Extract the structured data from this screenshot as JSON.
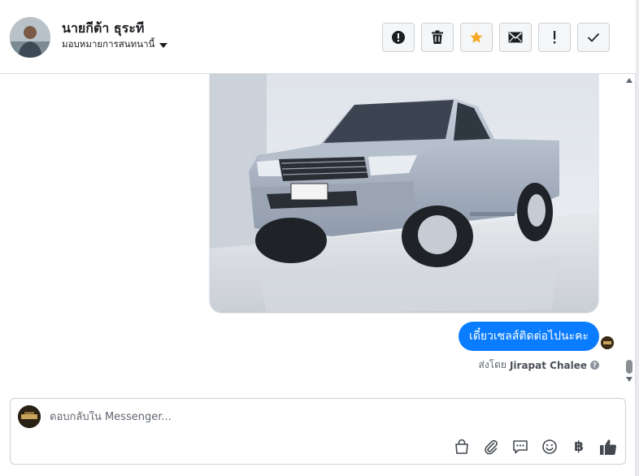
{
  "header": {
    "contact_name": "นายกีต้า ธุระที",
    "assign_label": "มอบหมายการสนทนานี้"
  },
  "actions": [
    {
      "name": "spam-button",
      "icon": "alert-circle-icon"
    },
    {
      "name": "delete-button",
      "icon": "trash-icon"
    },
    {
      "name": "star-button",
      "icon": "star-icon",
      "color": "#f5a623"
    },
    {
      "name": "mark-unread-button",
      "icon": "envelope-icon"
    },
    {
      "name": "follow-up-button",
      "icon": "exclamation-icon"
    },
    {
      "name": "mark-done-button",
      "icon": "check-icon"
    }
  ],
  "thread": {
    "message_text": "เดี๋ยวเซลส์ติดต่อไปนะคะ",
    "sent_by_prefix": "ส่งโดย",
    "sent_by_name": "Jirapat Chalee",
    "bubble_color": "#0a7cff"
  },
  "composer": {
    "placeholder": "ตอบกลับใน Messenger...",
    "baht_symbol": "฿"
  }
}
